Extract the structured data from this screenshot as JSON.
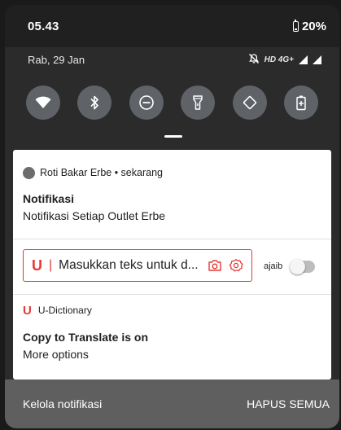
{
  "status_bar": {
    "time": "05.43",
    "battery": "20%"
  },
  "date_row": {
    "date": "Rab, 29 Jan",
    "network": "HD 4G+"
  },
  "quick_settings": [
    {
      "name": "wifi-icon"
    },
    {
      "name": "bluetooth-icon"
    },
    {
      "name": "do-not-disturb-icon"
    },
    {
      "name": "flashlight-icon"
    },
    {
      "name": "auto-rotate-icon"
    },
    {
      "name": "battery-saver-icon"
    }
  ],
  "notification_1": {
    "app": "Roti Bakar Erbe • sekarang",
    "title": "Notifikasi",
    "text": "Notifikasi Setiap Outlet Erbe"
  },
  "search_row": {
    "logo": "U",
    "placeholder": "Masukkan teks untuk d...",
    "toggle_label": "ajaib"
  },
  "notification_2": {
    "logo": "U",
    "app": "U-Dictionary",
    "title": "Copy to Translate is on",
    "text": "More options"
  },
  "footer": {
    "manage": "Kelola notifikasi",
    "clear_all": "HAPUS SEMUA"
  },
  "colors": {
    "accent_red": "#e53935",
    "panel_bg": "#2b2b2b",
    "tile": "#5f6368"
  }
}
